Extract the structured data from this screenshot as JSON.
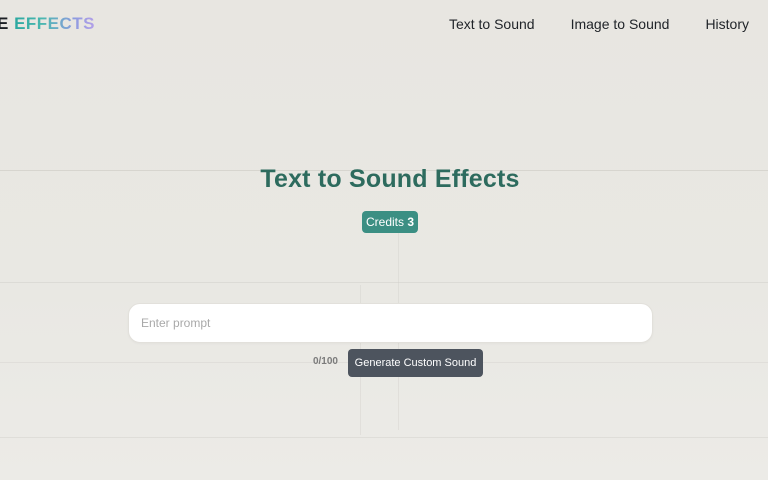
{
  "header": {
    "logo_prefix": "E",
    "logo_main": "EFFECTS",
    "nav": [
      {
        "label": "Text to Sound"
      },
      {
        "label": "Image to Sound"
      },
      {
        "label": "History"
      }
    ]
  },
  "main": {
    "title": "Text to Sound Effects",
    "credits_label": "Credits",
    "credits_value": "3",
    "prompt_placeholder": "Enter prompt",
    "prompt_value": "",
    "counter": "0/100",
    "generate_label": "Generate Custom Sound"
  },
  "colors": {
    "title": "#2d6b5e",
    "credits_badge": "#3b8f83",
    "generate_button": "#4d545e",
    "background": "#e9e7e2"
  }
}
